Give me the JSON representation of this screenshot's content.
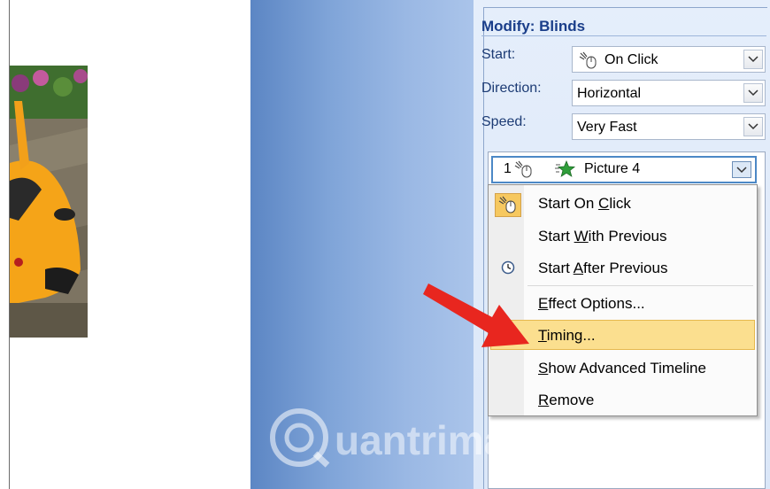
{
  "pane": {
    "title": "Modify: Blinds",
    "start_label": "Start:",
    "start_value": "On Click",
    "direction_label": "Direction:",
    "direction_value": "Horizontal",
    "speed_label": "Speed:",
    "speed_value": "Very Fast"
  },
  "effect_item": {
    "order": "1",
    "name": "Picture 4"
  },
  "menu": {
    "items": [
      {
        "pre": "Start On ",
        "key": "C",
        "post": "lick"
      },
      {
        "pre": "Start ",
        "key": "W",
        "post": "ith Previous"
      },
      {
        "pre": "Start ",
        "key": "A",
        "post": "fter Previous"
      },
      {
        "pre": "",
        "key": "E",
        "post": "ffect Options..."
      },
      {
        "pre": "",
        "key": "T",
        "post": "iming..."
      },
      {
        "pre": "",
        "key": "S",
        "post": "how Advanced Timeline"
      },
      {
        "pre": "",
        "key": "R",
        "post": "emove"
      }
    ]
  },
  "watermark": {
    "text": "uantrimang"
  },
  "colors": {
    "title": "#1a3e8a",
    "highlight": "#fbdf8f",
    "arrow": "#e8261f"
  }
}
